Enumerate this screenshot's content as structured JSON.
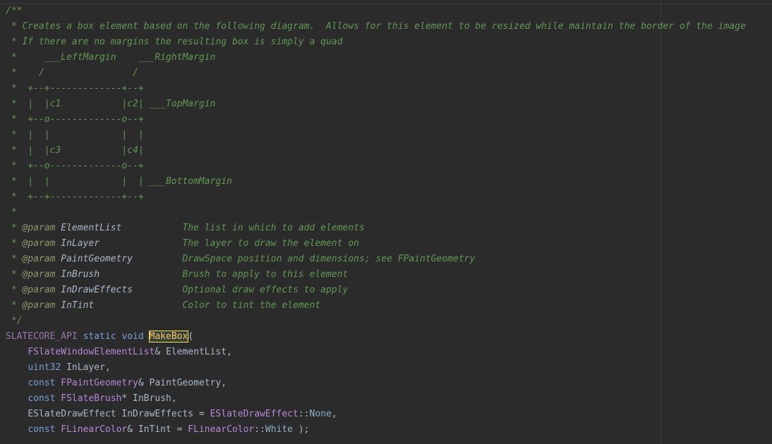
{
  "editor": {
    "doc_lines": [
      "/**",
      " * Creates a box element based on the following diagram.  Allows for this element to be resized while maintain the border of the image",
      " * If there are no margins the resulting box is simply a quad",
      " *     ___LeftMargin    ___RightMargin",
      " *    /                /",
      " *  +--+-------------+--+",
      " *  |  |c1           |c2| ___TopMargin",
      " *  +--o-------------o--+",
      " *  |  |             |  |",
      " *  |  |c3           |c4|",
      " *  +--o-------------o--+",
      " *  |  |             |  | ___BottomMargin",
      " *  +--+-------------+--+",
      " *"
    ],
    "params": [
      {
        "tag": "@param",
        "name": "ElementList",
        "pad": "           ",
        "desc": "The list in which to add elements"
      },
      {
        "tag": "@param",
        "name": "InLayer",
        "pad": "               ",
        "desc": "The layer to draw the element on"
      },
      {
        "tag": "@param",
        "name": "PaintGeometry",
        "pad": "         ",
        "desc": "DrawSpace position and dimensions; see FPaintGeometry"
      },
      {
        "tag": "@param",
        "name": "InBrush",
        "pad": "               ",
        "desc": "Brush to apply to this element"
      },
      {
        "tag": "@param",
        "name": "InDrawEffects",
        "pad": "         ",
        "desc": "Optional draw effects to apply"
      },
      {
        "tag": "@param",
        "name": "InTint",
        "pad": "                ",
        "desc": "Color to tint the element"
      }
    ],
    "doc_prefix": " * ",
    "doc_close": " */",
    "signature": {
      "macro": "SLATECORE_API",
      "static_kw": "static",
      "void_kw": "void",
      "function_name": "MakeBox",
      "open_paren": "("
    },
    "args": {
      "a1_type": "FSlateWindowElementList",
      "a1_rest": "& ElementList,",
      "a2_type": "uint32",
      "a2_rest": " InLayer,",
      "a3_const": "const",
      "a3_type": "FPaintGeometry",
      "a3_rest": "& PaintGeometry,",
      "a4_const": "const",
      "a4_type": "FSlateBrush",
      "a4_rest": "* InBrush,",
      "a5_type": "ESlateDrawEffect",
      "a5_mid": " InDrawEffects = ",
      "a5_enum": "ESlateDrawEffect",
      "a5_sep": "::",
      "a5_val": "None",
      "a5_end": ",",
      "a6_const": "const",
      "a6_type": "FLinearColor",
      "a6_mid": "& InTint = ",
      "a6_enum": "FLinearColor",
      "a6_sep": "::",
      "a6_val": "White",
      "a6_end": " );"
    },
    "colors": {
      "background": "#2b2b2b",
      "comment": "#629755",
      "keyword": "#7a9fd6",
      "type": "#b589d6",
      "function_highlight": "#ffc66d",
      "highlight_border": "#ffdf5d"
    }
  }
}
